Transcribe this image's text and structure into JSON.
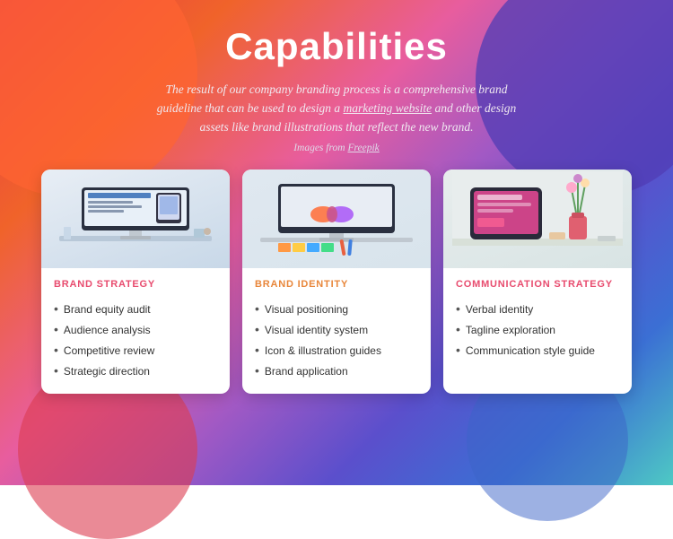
{
  "page": {
    "title": "Capabilities",
    "subtitle_part1": "The result of our company branding process is a comprehensive brand guideline that can be used to design a ",
    "subtitle_link": "marketing website",
    "subtitle_part2": " and other design assets like brand illustrations that reflect the new brand.",
    "image_credit_prefix": "Images from ",
    "image_credit_link": "Freepik"
  },
  "cards": [
    {
      "id": "brand-strategy",
      "category": "BRAND STRATEGY",
      "category_color": "#e84b6e",
      "items": [
        "Brand equity audit",
        "Audience analysis",
        "Competitive review",
        "Strategic direction"
      ]
    },
    {
      "id": "brand-identity",
      "category": "BRAND IDENTITY",
      "category_color": "#e8863a",
      "items": [
        "Visual positioning",
        "Visual identity system",
        "Icon & illustration guides",
        "Brand application"
      ]
    },
    {
      "id": "communication-strategy",
      "category": "COMMUNICATION STRATEGY",
      "category_color": "#e84b6e",
      "items": [
        "Verbal identity",
        "Tagline exploration",
        "Communication style guide"
      ]
    }
  ]
}
